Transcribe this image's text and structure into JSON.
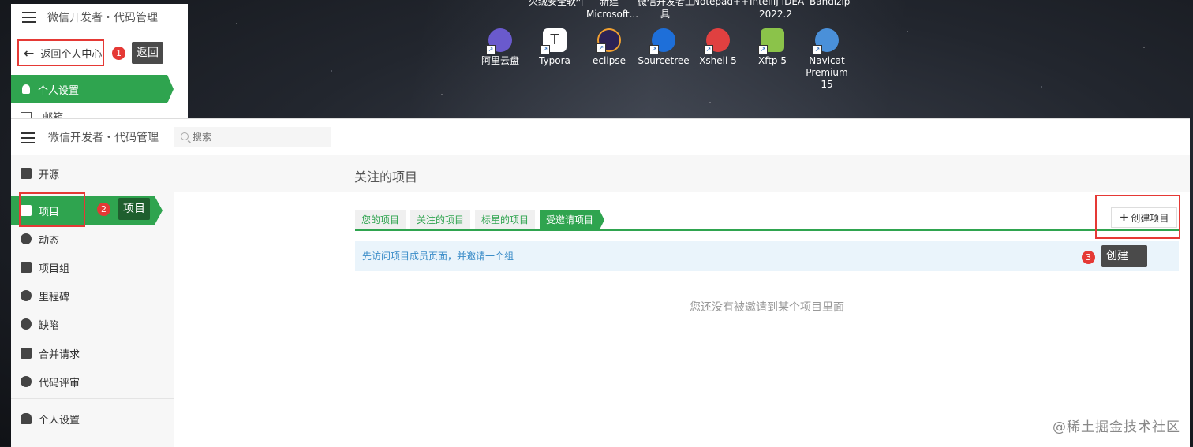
{
  "desktop": {
    "top_labels": [
      "火绒安全软件",
      "新建",
      "Microsoft...",
      "微信开发者工",
      "具",
      "Notepad++",
      "IntelliJ IDEA",
      "2022.2",
      "Bandizip"
    ],
    "icons": [
      {
        "name": "阿里云盘",
        "icon": "aliyun-drive-icon",
        "color": "#6a5acd"
      },
      {
        "name": "Typora",
        "icon": "typora-icon",
        "color": "#ffffff"
      },
      {
        "name": "eclipse",
        "icon": "eclipse-icon",
        "color": "#2c2255"
      },
      {
        "name": "Sourcetree",
        "icon": "sourcetree-icon",
        "color": "#1e6fd9"
      },
      {
        "name": "Xshell 5",
        "icon": "xshell-icon",
        "color": "#e04040"
      },
      {
        "name": "Xftp 5",
        "icon": "xftp-icon",
        "color": "#8bc34a"
      },
      {
        "name": "Navicat",
        "name2": "Premium 15",
        "icon": "navicat-icon",
        "color": "#4a90d9"
      }
    ]
  },
  "mini_panel": {
    "title": "微信开发者・代码管理",
    "back_label": "返回个人中心",
    "badge": "1",
    "tooltip": "返回",
    "active_item": "个人设置",
    "partial_item": "邮箱"
  },
  "header": {
    "title": "微信开发者・代码管理",
    "search_placeholder": "搜索"
  },
  "sidebar": {
    "items": [
      {
        "label": "开源",
        "icon": "map-icon"
      },
      {
        "label": "项目",
        "icon": "home-icon"
      },
      {
        "label": "动态",
        "icon": "dashboard-icon"
      },
      {
        "label": "项目组",
        "icon": "group-icon"
      },
      {
        "label": "里程碑",
        "icon": "clock-icon"
      },
      {
        "label": "缺陷",
        "icon": "alert-icon"
      },
      {
        "label": "合并请求",
        "icon": "server-icon"
      },
      {
        "label": "代码评审",
        "icon": "check-circle-icon"
      },
      {
        "label": "个人设置",
        "icon": "user-icon"
      }
    ],
    "badge": "2",
    "tooltip": "项目"
  },
  "main": {
    "section_title": "关注的项目",
    "tabs": [
      "您的项目",
      "关注的项目",
      "标星的项目",
      "受邀请项目"
    ],
    "active_tab": "受邀请项目",
    "create_button": "创建项目",
    "badge": "3",
    "tooltip": "创建",
    "info_text": "先访问项目成员页面，并邀请一个组",
    "empty_text": "您还没有被邀请到某个项目里面"
  },
  "watermark": "@稀土掘金技术社区",
  "colors": {
    "accent": "#2fa44f",
    "highlight": "#e53935",
    "info_text": "#3a8cc8"
  }
}
